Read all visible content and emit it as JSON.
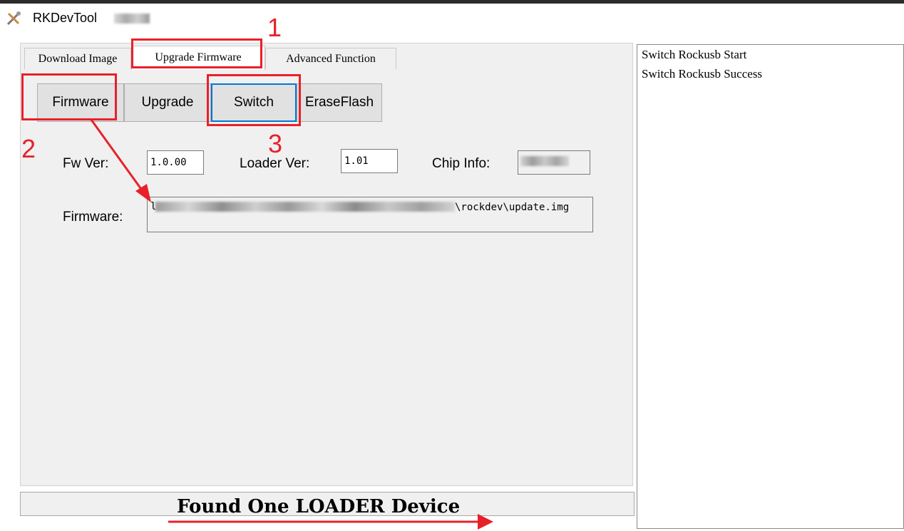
{
  "window": {
    "title": "RKDevTool"
  },
  "tabs": [
    {
      "label": "Download Image"
    },
    {
      "label": "Upgrade Firmware"
    },
    {
      "label": "Advanced Function"
    }
  ],
  "buttons": {
    "firmware": "Firmware",
    "upgrade": "Upgrade",
    "switch": "Switch",
    "erase": "EraseFlash"
  },
  "fields": {
    "fw_ver_label": "Fw Ver:",
    "fw_ver_value": "1.0.00",
    "loader_ver_label": "Loader Ver:",
    "loader_ver_value": "1.01",
    "chip_info_label": "Chip Info:",
    "chip_info_value": "",
    "firmware_label": "Firmware:",
    "firmware_path_suffix": "\\rockdev\\update.img",
    "firmware_path_prefix": "l"
  },
  "log": [
    "Switch Rockusb Start",
    "Switch Rockusb Success"
  ],
  "status": "Found One LOADER Device",
  "annotations": {
    "n1": "1",
    "n2": "2",
    "n3": "3"
  },
  "colors": {
    "annotation": "#e8202a",
    "focus": "#0078d7"
  }
}
